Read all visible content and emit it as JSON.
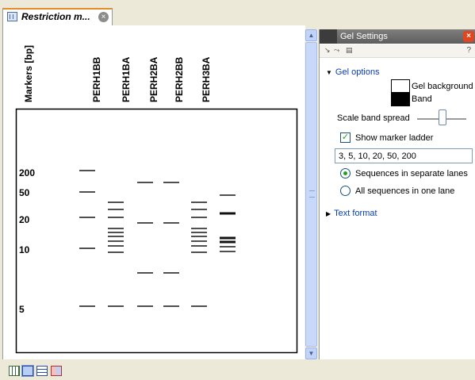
{
  "tab": {
    "title": "Restriction m...",
    "close": "×"
  },
  "gel": {
    "marker_label": "Markers [bp]",
    "lanes": [
      "PERH1BB",
      "PERH1BA",
      "PERH2BA",
      "PERH2BB",
      "PERH3BA"
    ],
    "marker_ticks": [
      "200",
      "50",
      "20",
      "10",
      "5"
    ]
  },
  "panel": {
    "title": "Gel Settings",
    "help": "?",
    "gel_options": "Gel options",
    "gel_background": "Gel background",
    "band": "Band",
    "scale_band_spread": "Scale band spread",
    "show_marker_ladder": "Show marker ladder",
    "show_marker_ladder_checked": true,
    "ladder_values": "3, 5, 10, 20, 50, 200",
    "sequences_separate": "Sequences in separate lanes",
    "all_sequences_one": "All sequences in one lane",
    "selected_option": "Sequences in separate lanes",
    "text_format": "Text format"
  },
  "colors": {
    "accent_link": "#0a3cb4",
    "tab_highlight": "#e68b2c",
    "band": "#505050"
  }
}
